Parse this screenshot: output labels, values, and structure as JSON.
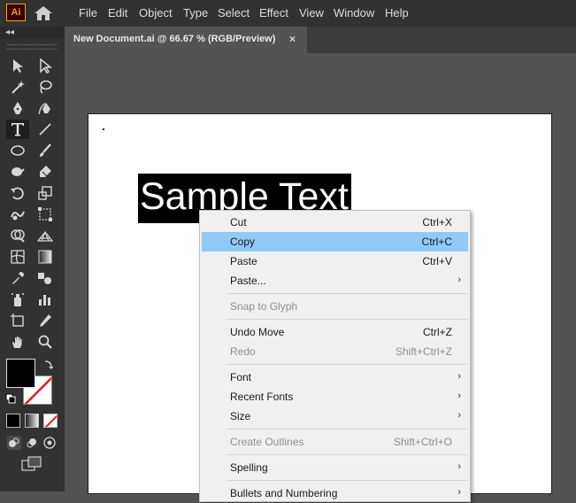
{
  "app": {
    "logo_text": "Ai"
  },
  "menubar": {
    "items": [
      "File",
      "Edit",
      "Object",
      "Type",
      "Select",
      "Effect",
      "View",
      "Window",
      "Help"
    ]
  },
  "panel": {
    "collapse_label": "◂◂"
  },
  "document": {
    "tab_title": "New Document.ai @ 66.67 % (RGB/Preview)",
    "close_label": "×"
  },
  "artboard": {
    "text": "Sample Text"
  },
  "context_menu": {
    "items": [
      {
        "label": "Cut",
        "shortcut": "Ctrl+X",
        "enabled": true
      },
      {
        "label": "Copy",
        "shortcut": "Ctrl+C",
        "enabled": true,
        "highlighted": true
      },
      {
        "label": "Paste",
        "shortcut": "Ctrl+V",
        "enabled": true
      },
      {
        "label": "Paste...",
        "shortcut": "",
        "submenu": true,
        "enabled": true
      },
      {
        "label": "Snap to Glyph",
        "shortcut": "",
        "enabled": false
      },
      {
        "label": "Undo Move",
        "shortcut": "Ctrl+Z",
        "enabled": true
      },
      {
        "label": "Redo",
        "shortcut": "Shift+Ctrl+Z",
        "enabled": false
      },
      {
        "label": "Font",
        "shortcut": "",
        "submenu": true,
        "enabled": true
      },
      {
        "label": "Recent Fonts",
        "shortcut": "",
        "submenu": true,
        "enabled": true
      },
      {
        "label": "Size",
        "shortcut": "",
        "submenu": true,
        "enabled": true
      },
      {
        "label": "Create Outlines",
        "shortcut": "Shift+Ctrl+O",
        "enabled": false
      },
      {
        "label": "Spelling",
        "shortcut": "",
        "submenu": true,
        "enabled": true
      },
      {
        "label": "Bullets and Numbering",
        "shortcut": "",
        "submenu": true,
        "enabled": true
      }
    ]
  },
  "colors": {
    "highlight": "#91c9f7",
    "accent": "#ff9a00",
    "fill": "#000000",
    "stroke_none": "#e01c1c"
  },
  "tools": [
    "selection-tool",
    "direct-selection-tool",
    "magic-wand-tool",
    "lasso-tool",
    "pen-tool",
    "curvature-tool",
    "type-tool",
    "line-segment-tool",
    "ellipse-tool",
    "paintbrush-tool",
    "shaper-tool",
    "eraser-tool",
    "rotate-tool",
    "scale-tool",
    "warp-tool",
    "free-transform-tool",
    "shape-builder-tool",
    "perspective-grid-tool",
    "mesh-tool",
    "gradient-tool",
    "eyedropper-tool",
    "blend-tool",
    "symbol-sprayer-tool",
    "column-graph-tool",
    "artboard-tool",
    "slice-tool",
    "hand-tool",
    "zoom-tool"
  ]
}
